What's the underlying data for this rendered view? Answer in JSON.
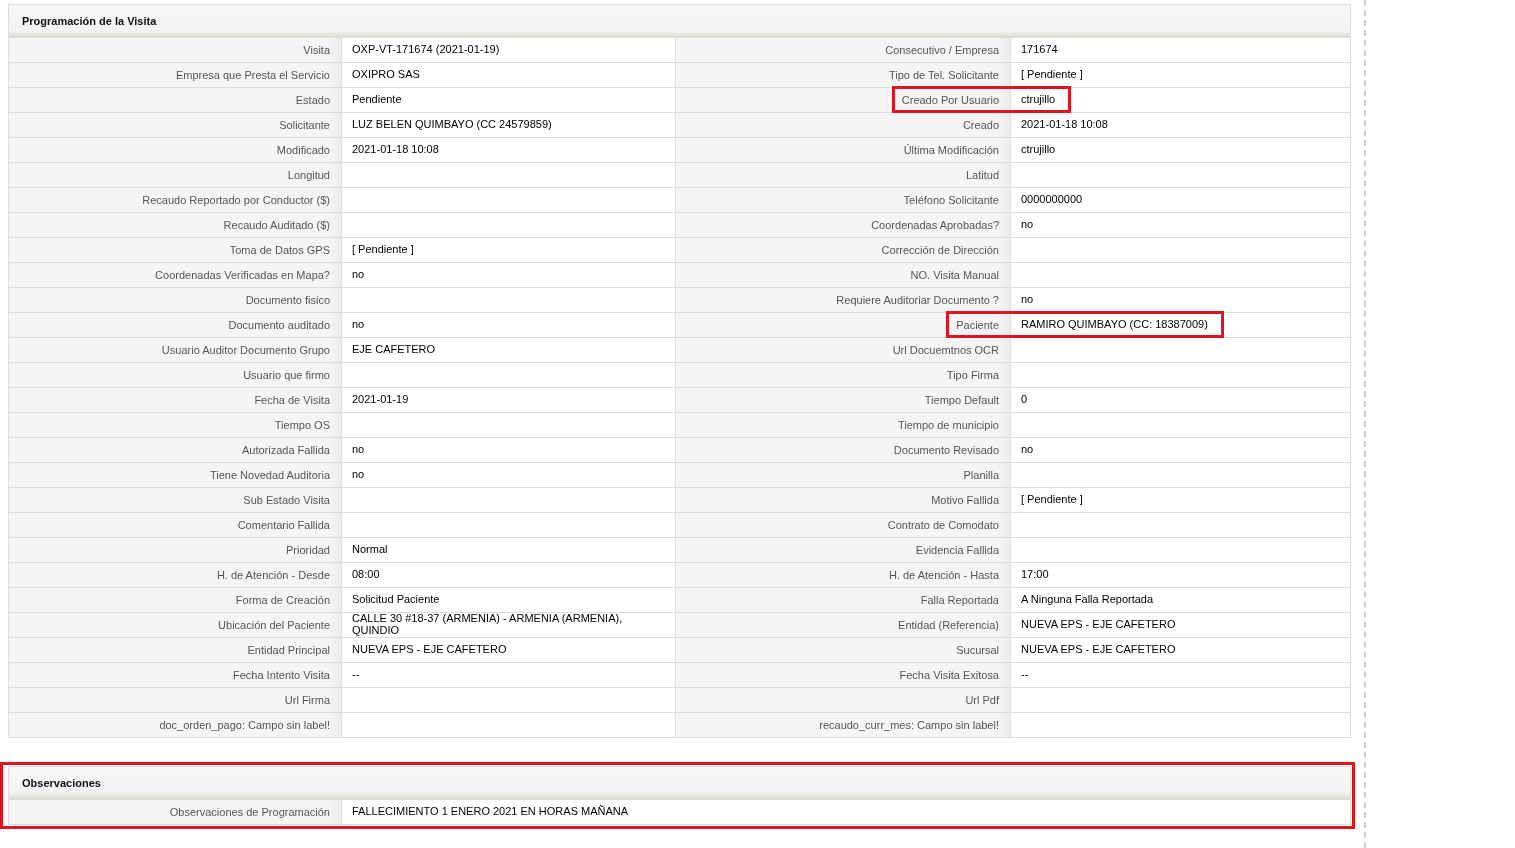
{
  "sections": [
    {
      "title": "Programación de la Visita",
      "highlighted": false,
      "rows": [
        [
          {
            "label": "Visita",
            "value": "OXP-VT-171674 (2021-01-19)",
            "highlighted": false
          },
          {
            "label": "Consecutivo / Empresa",
            "value": "171674",
            "highlighted": false
          }
        ],
        [
          {
            "label": "Empresa que Presta el Servicio",
            "value": "OXIPRO SAS",
            "highlighted": false
          },
          {
            "label": "Tipo de Tel. Solicitante",
            "value": "[ Pendiente ]",
            "highlighted": false
          }
        ],
        [
          {
            "label": "Estado",
            "value": "Pendiente",
            "highlighted": false
          },
          {
            "label": "Creado Por Usuario",
            "value": "ctrujillo",
            "highlighted": true
          }
        ],
        [
          {
            "label": "Solicitante",
            "value": "LUZ BELEN QUIMBAYO (CC 24579859)",
            "highlighted": false
          },
          {
            "label": "Creado",
            "value": "2021-01-18 10:08",
            "highlighted": false
          }
        ],
        [
          {
            "label": "Modificado",
            "value": "2021-01-18 10:08",
            "highlighted": false
          },
          {
            "label": "Última Modificación",
            "value": "ctrujillo",
            "highlighted": false
          }
        ],
        [
          {
            "label": "Longitud",
            "highlighted": false
          },
          {
            "label": "Latitud",
            "highlighted": false
          }
        ],
        [
          {
            "label": "Recaudo Reportado por Conductor ($)",
            "highlighted": false
          },
          {
            "label": "Teléfono Solicitante",
            "value": "0000000000",
            "highlighted": false
          }
        ],
        [
          {
            "label": "Recaudo Auditado ($)",
            "highlighted": false
          },
          {
            "label": "Coordenadas Aprobadas?",
            "value": "no",
            "highlighted": false
          }
        ],
        [
          {
            "label": "Toma de Datos GPS",
            "value": "[ Pendiente ]",
            "highlighted": false
          },
          {
            "label": "Corrección de Dirección",
            "highlighted": false
          }
        ],
        [
          {
            "label": "Coordenadas Verificadas en Mapa?",
            "value": "no",
            "highlighted": false
          },
          {
            "label": "NO. Visita Manual",
            "highlighted": false
          }
        ],
        [
          {
            "label": "Documento fisico",
            "highlighted": false
          },
          {
            "label": "Requiere Auditoriar Documento ?",
            "value": "no",
            "highlighted": false
          }
        ],
        [
          {
            "label": "Documento auditado",
            "value": "no",
            "highlighted": false
          },
          {
            "label": "Paciente",
            "value": "RAMIRO QUIMBAYO (CC: 18387009)",
            "highlighted": true
          }
        ],
        [
          {
            "label": "Usuario Auditor Documento Grupo",
            "value": "EJE CAFETERO",
            "highlighted": false
          },
          {
            "label": "Url Docuemtnos OCR",
            "highlighted": false
          }
        ],
        [
          {
            "label": "Usuario que firmo",
            "highlighted": false
          },
          {
            "label": "Tipo Firma",
            "highlighted": false
          }
        ],
        [
          {
            "label": "Fecha de Visita",
            "value": "2021-01-19",
            "highlighted": false
          },
          {
            "label": "Tiempo Default",
            "value": "0",
            "highlighted": false
          }
        ],
        [
          {
            "label": "Tiempo OS",
            "highlighted": false
          },
          {
            "label": "Tiempo de municipio",
            "highlighted": false
          }
        ],
        [
          {
            "label": "Autorizada Fallida",
            "value": "no",
            "highlighted": false
          },
          {
            "label": "Documento Revisado",
            "value": "no",
            "highlighted": false
          }
        ],
        [
          {
            "label": "Tiene Novedad Auditoria",
            "value": "no",
            "highlighted": false
          },
          {
            "label": "Planilla",
            "highlighted": false
          }
        ],
        [
          {
            "label": "Sub Estado Visita",
            "highlighted": false
          },
          {
            "label": "Motivo Fallida",
            "value": "[ Pendiente ]",
            "highlighted": false
          }
        ],
        [
          {
            "label": "Comentario Fallida",
            "highlighted": false
          },
          {
            "label": "Contrato de Comodato",
            "highlighted": false
          }
        ],
        [
          {
            "label": "Prioridad",
            "value": "Normal",
            "highlighted": false
          },
          {
            "label": "Evidencia Fallida",
            "highlighted": false
          }
        ],
        [
          {
            "label": "H. de Atención - Desde",
            "value": "08:00",
            "highlighted": false
          },
          {
            "label": "H. de Atención - Hasta",
            "value": "17:00",
            "highlighted": false
          }
        ],
        [
          {
            "label": "Forma de Creación",
            "value": "Solicitud Paciente",
            "highlighted": false
          },
          {
            "label": "Falla Reportada",
            "value": "A Ninguna Falla Reportada",
            "highlighted": false
          }
        ],
        [
          {
            "label": "Ubicación del Paciente",
            "value": "CALLE 30 #18-37 (ARMENIA) - ARMENIA (ARMENIA), QUINDIO",
            "highlighted": false
          },
          {
            "label": "Entidad (Referencia)",
            "value": "NUEVA EPS - EJE CAFETERO",
            "highlighted": false
          }
        ],
        [
          {
            "label": "Entidad Principal",
            "value": "NUEVA EPS - EJE CAFETERO",
            "highlighted": false
          },
          {
            "label": "Sucursal",
            "value": "NUEVA EPS - EJE CAFETERO",
            "highlighted": false
          }
        ],
        [
          {
            "label": "Fecha Intento Visita",
            "value": "--",
            "highlighted": false
          },
          {
            "label": "Fecha Visita Exitosa",
            "value": "--",
            "highlighted": false
          }
        ],
        [
          {
            "label": "Url Firma",
            "highlighted": false
          },
          {
            "label": "Url Pdf",
            "highlighted": false
          }
        ],
        [
          {
            "label": "doc_orden_pago: Campo sin label!",
            "highlighted": false
          },
          {
            "label": "recaudo_curr_mes: Campo sin label!",
            "highlighted": false
          }
        ]
      ]
    },
    {
      "title": "Observaciones",
      "highlighted": true,
      "rows": [
        [
          {
            "label": "Observaciones de Programación",
            "value": "FALLECIMIENTO 1 ENERO 2021 EN HORAS MAÑANA",
            "highlighted": false
          }
        ]
      ]
    }
  ]
}
